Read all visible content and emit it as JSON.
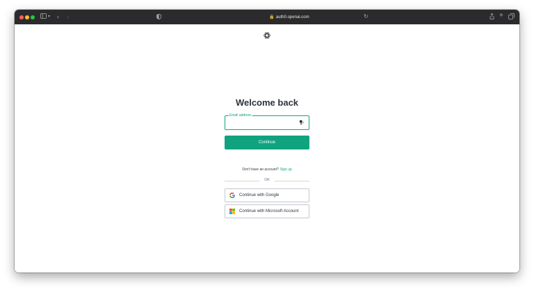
{
  "browser": {
    "url": "auth0.openai.com"
  },
  "login": {
    "title": "Welcome back",
    "email_label": "Email address",
    "email_value": "",
    "continue_label": "Continue",
    "no_account_text": "Don't have an account?",
    "sign_up_label": "Sign up",
    "divider_text": "OR",
    "google_label": "Continue with Google",
    "microsoft_label": "Continue with Microsoft Account"
  },
  "colors": {
    "accent": "#10a37f",
    "text": "#2d333a",
    "toolbar": "#2b2b2d"
  },
  "icons": [
    "sidebar-icon",
    "back-icon",
    "forward-icon",
    "shield-icon",
    "lock-icon",
    "reload-icon",
    "share-icon",
    "new-tab-icon",
    "tabs-overview-icon",
    "openai-logo-icon",
    "key-icon",
    "google-icon",
    "microsoft-icon"
  ]
}
